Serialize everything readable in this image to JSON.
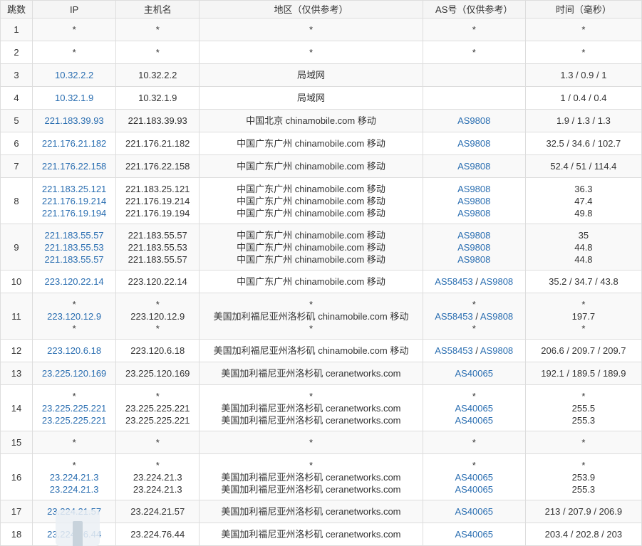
{
  "headers": [
    "跳数",
    "IP",
    "主机名",
    "地区（仅供参考）",
    "AS号（仅供参考）",
    "时间（毫秒）"
  ],
  "colors": {
    "link": "#2a6eb1",
    "border": "#dddddd",
    "header_bg": "#f5f5f5",
    "stripe_bg": "#f9f9f9"
  },
  "rows": [
    {
      "hop": "1",
      "ip": [
        "*"
      ],
      "host": [
        "*"
      ],
      "region": [
        "*"
      ],
      "as": [
        "*"
      ],
      "time": [
        "*"
      ]
    },
    {
      "hop": "2",
      "ip": [
        "*"
      ],
      "host": [
        "*"
      ],
      "region": [
        "*"
      ],
      "as": [
        "*"
      ],
      "time": [
        "*"
      ]
    },
    {
      "hop": "3",
      "ip": [
        "10.32.2.2"
      ],
      "host": [
        "10.32.2.2"
      ],
      "region": [
        "局域网"
      ],
      "as": [
        ""
      ],
      "time": [
        "1.3 / 0.9 / 1"
      ]
    },
    {
      "hop": "4",
      "ip": [
        "10.32.1.9"
      ],
      "host": [
        "10.32.1.9"
      ],
      "region": [
        "局域网"
      ],
      "as": [
        ""
      ],
      "time": [
        "1 / 0.4 / 0.4"
      ]
    },
    {
      "hop": "5",
      "ip": [
        "221.183.39.93"
      ],
      "host": [
        "221.183.39.93"
      ],
      "region": [
        "中国北京 chinamobile.com 移动"
      ],
      "as": [
        "AS9808"
      ],
      "time": [
        "1.9 / 1.3 / 1.3"
      ]
    },
    {
      "hop": "6",
      "ip": [
        "221.176.21.182"
      ],
      "host": [
        "221.176.21.182"
      ],
      "region": [
        "中国广东广州 chinamobile.com 移动"
      ],
      "as": [
        "AS9808"
      ],
      "time": [
        "32.5 / 34.6 / 102.7"
      ]
    },
    {
      "hop": "7",
      "ip": [
        "221.176.22.158"
      ],
      "host": [
        "221.176.22.158"
      ],
      "region": [
        "中国广东广州 chinamobile.com 移动"
      ],
      "as": [
        "AS9808"
      ],
      "time": [
        "52.4 / 51 / 114.4"
      ]
    },
    {
      "hop": "8",
      "ip": [
        "221.183.25.121",
        "221.176.19.214",
        "221.176.19.194"
      ],
      "host": [
        "221.183.25.121",
        "221.176.19.214",
        "221.176.19.194"
      ],
      "region": [
        "中国广东广州 chinamobile.com 移动",
        "中国广东广州 chinamobile.com 移动",
        "中国广东广州 chinamobile.com 移动"
      ],
      "as": [
        "AS9808",
        "AS9808",
        "AS9808"
      ],
      "time": [
        "36.3",
        "47.4",
        "49.8"
      ]
    },
    {
      "hop": "9",
      "ip": [
        "221.183.55.57",
        "221.183.55.53",
        "221.183.55.57"
      ],
      "host": [
        "221.183.55.57",
        "221.183.55.53",
        "221.183.55.57"
      ],
      "region": [
        "中国广东广州 chinamobile.com 移动",
        "中国广东广州 chinamobile.com 移动",
        "中国广东广州 chinamobile.com 移动"
      ],
      "as": [
        "AS9808",
        "AS9808",
        "AS9808"
      ],
      "time": [
        "35",
        "44.8",
        "44.8"
      ]
    },
    {
      "hop": "10",
      "ip": [
        "223.120.22.14"
      ],
      "host": [
        "223.120.22.14"
      ],
      "region": [
        "中国广东广州 chinamobile.com 移动"
      ],
      "as": [
        "AS58453 / AS9808"
      ],
      "time": [
        "35.2 / 34.7 / 43.8"
      ]
    },
    {
      "hop": "11",
      "ip": [
        "*",
        "223.120.12.9",
        "*"
      ],
      "host": [
        "*",
        "223.120.12.9",
        "*"
      ],
      "region": [
        "*",
        "美国加利福尼亚州洛杉矶 chinamobile.com 移动",
        "*"
      ],
      "as": [
        "*",
        "AS58453 / AS9808",
        "*"
      ],
      "time": [
        "*",
        "197.7",
        "*"
      ]
    },
    {
      "hop": "12",
      "ip": [
        "223.120.6.18"
      ],
      "host": [
        "223.120.6.18"
      ],
      "region": [
        "美国加利福尼亚州洛杉矶 chinamobile.com 移动"
      ],
      "as": [
        "AS58453 / AS9808"
      ],
      "time": [
        "206.6 / 209.7 / 209.7"
      ]
    },
    {
      "hop": "13",
      "ip": [
        "23.225.120.169"
      ],
      "host": [
        "23.225.120.169"
      ],
      "region": [
        "美国加利福尼亚州洛杉矶 ceranetworks.com"
      ],
      "as": [
        "AS40065"
      ],
      "time": [
        "192.1 / 189.5 / 189.9"
      ]
    },
    {
      "hop": "14",
      "ip": [
        "*",
        "23.225.225.221",
        "23.225.225.221"
      ],
      "host": [
        "*",
        "23.225.225.221",
        "23.225.225.221"
      ],
      "region": [
        "*",
        "美国加利福尼亚州洛杉矶 ceranetworks.com",
        "美国加利福尼亚州洛杉矶 ceranetworks.com"
      ],
      "as": [
        "*",
        "AS40065",
        "AS40065"
      ],
      "time": [
        "*",
        "255.5",
        "255.3"
      ]
    },
    {
      "hop": "15",
      "ip": [
        "*"
      ],
      "host": [
        "*"
      ],
      "region": [
        "*"
      ],
      "as": [
        "*"
      ],
      "time": [
        "*"
      ]
    },
    {
      "hop": "16",
      "ip": [
        "*",
        "23.224.21.3",
        "23.224.21.3"
      ],
      "host": [
        "*",
        "23.224.21.3",
        "23.224.21.3"
      ],
      "region": [
        "*",
        "美国加利福尼亚州洛杉矶 ceranetworks.com",
        "美国加利福尼亚州洛杉矶 ceranetworks.com"
      ],
      "as": [
        "*",
        "AS40065",
        "AS40065"
      ],
      "time": [
        "*",
        "253.9",
        "255.3"
      ]
    },
    {
      "hop": "17",
      "ip": [
        "23.224.21.57"
      ],
      "host": [
        "23.224.21.57"
      ],
      "region": [
        "美国加利福尼亚州洛杉矶 ceranetworks.com"
      ],
      "as": [
        "AS40065"
      ],
      "time": [
        "213 / 207.9 / 206.9"
      ]
    },
    {
      "hop": "18",
      "ip": [
        "23.224.76.44"
      ],
      "host": [
        "23.224.76.44"
      ],
      "region": [
        "美国加利福尼亚州洛杉矶 ceranetworks.com"
      ],
      "as": [
        "AS40065"
      ],
      "time": [
        "203.4 / 202.8 / 203"
      ]
    }
  ]
}
